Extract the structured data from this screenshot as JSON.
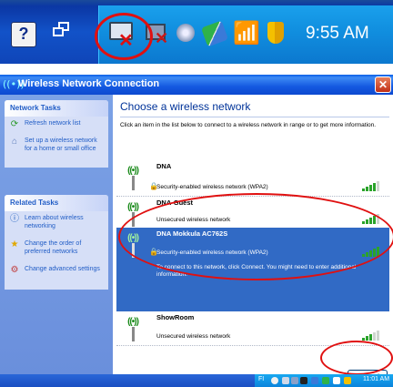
{
  "tray": {
    "clock": "9:55 AM"
  },
  "window": {
    "title": "Wireless Network Connection",
    "close_glyph": "✕"
  },
  "left_pane": {
    "network_tasks": {
      "title": "Network Tasks",
      "items": [
        {
          "label": "Refresh network list",
          "icon": "refresh-icon"
        },
        {
          "label": "Set up a wireless network for a home or small office",
          "icon": "setup-network-icon"
        }
      ]
    },
    "related_tasks": {
      "title": "Related Tasks",
      "items": [
        {
          "label": "Learn about wireless networking",
          "icon": "info-icon"
        },
        {
          "label": "Change the order of preferred networks",
          "icon": "star-icon"
        },
        {
          "label": "Change advanced settings",
          "icon": "settings-icon"
        }
      ]
    }
  },
  "main": {
    "heading": "Choose a wireless network",
    "instructions": "Click an item in the list below to connect to a wireless network in range or to get more information.",
    "networks": [
      {
        "ssid": "DNA",
        "security": "Security-enabled wireless network (WPA2)",
        "signal": 4
      },
      {
        "ssid": "DNA-Guest",
        "security": "Unsecured wireless network",
        "signal": 4
      },
      {
        "ssid": "DNA Mokkula AC762S",
        "security": "Security-enabled wireless network (WPA2)",
        "signal": 5,
        "detail": "To connect to this network, click Connect. You might need to enter additional information."
      },
      {
        "ssid": "ShowRoom",
        "security": "Unsecured wireless network",
        "signal": 3
      }
    ],
    "connect_label": "Connect"
  },
  "taskbar": {
    "language": "FI",
    "clock": "11:01 AM"
  },
  "colors": {
    "selection": "#316ac5",
    "annotation_red": "#e01010",
    "task_link": "#215dc6",
    "signal_green": "#2aa32a"
  }
}
